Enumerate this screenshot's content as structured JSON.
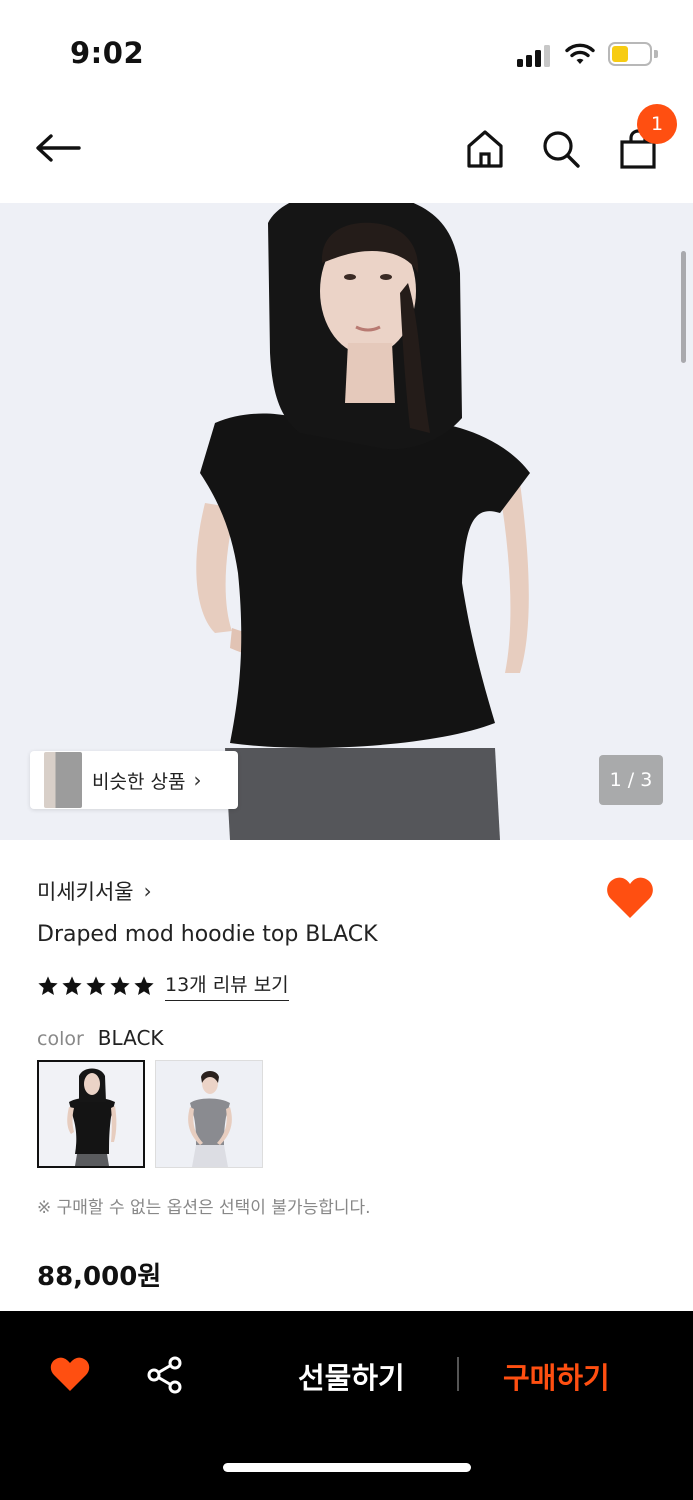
{
  "status_bar": {
    "time": "9:02",
    "icons": [
      "signal-icon",
      "wifi-icon",
      "battery-icon"
    ]
  },
  "header": {
    "icons": [
      "back-arrow-icon",
      "home-icon",
      "search-icon",
      "shopping-bag-icon"
    ],
    "cart_count": "1"
  },
  "gallery": {
    "similar_products_label": "비슷한 상품",
    "page_counter": "1 / 3"
  },
  "product": {
    "brand": "미세키서울",
    "title": "Draped mod hoodie top BLACK",
    "rating_stars": 5,
    "review_link": "13개 리뷰 보기",
    "color_label": "color",
    "color_value": "BLACK",
    "color_options": [
      "BLACK",
      "GRAY"
    ],
    "notice": "※ 구매할 수 없는 옵션은 선택이 불가능합니다.",
    "price": "88,000원",
    "wished": true
  },
  "bottom_bar": {
    "gift_label": "선물하기",
    "buy_label": "구매하기",
    "icons": [
      "heart-icon",
      "share-icon"
    ]
  },
  "colors": {
    "accent": "#ff4f11",
    "bottom_bar_bg": "#000000",
    "battery": "#f7cc13"
  }
}
